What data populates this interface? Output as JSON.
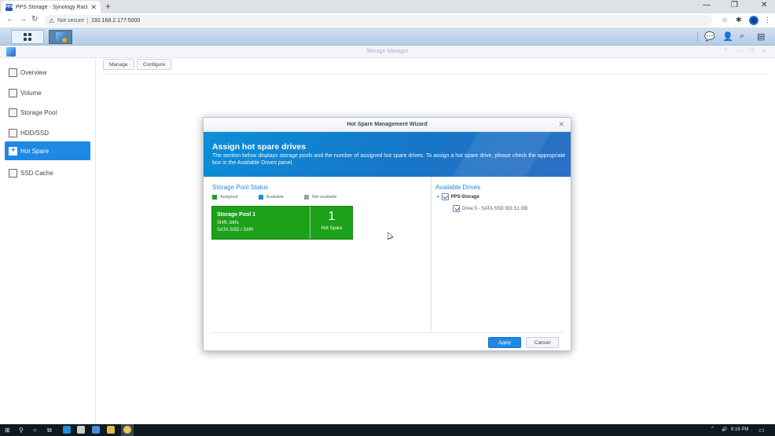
{
  "browser": {
    "tab_title": "PPS Storage - Synology RackSta",
    "tab_favicon_label": "PPS",
    "new_tab_symbol": "+",
    "url_security": "Not secure",
    "url": "192.168.2.177:5000"
  },
  "window": {
    "title": "Storage Manager"
  },
  "sidebar": {
    "items": [
      {
        "label": "Overview",
        "icon": "overview-icon",
        "active": false
      },
      {
        "label": "Volume",
        "icon": "volume-icon",
        "active": false
      },
      {
        "label": "Storage Pool",
        "icon": "storage-pool-icon",
        "active": false
      },
      {
        "label": "HDD/SSD",
        "icon": "hdd-icon",
        "active": false
      },
      {
        "label": "Hot Spare",
        "icon": "hot-spare-icon",
        "active": true
      },
      {
        "label": "SSD Cache",
        "icon": "ssd-cache-icon",
        "active": false
      }
    ]
  },
  "toolbar": {
    "manage_label": "Manage",
    "configure_label": "Configure"
  },
  "wizard": {
    "title": "Hot Spare Management Wizard",
    "heading": "Assign hot spare drives",
    "description": "The section below displays storage pools and the number of assigned hot spare drives. To assign a hot spare drive, please check the appropriate box in the Available Drives panel.",
    "pool_status_title": "Storage Pool Status",
    "legend": {
      "assigned": "Assigned",
      "available": "Available",
      "not_available": "Not available"
    },
    "pool": {
      "name": "Storage Pool 1",
      "type": "SHR, btrfs",
      "media": "SATA SSD / SHR",
      "hot_spare_count": "1",
      "hot_spare_label": "Hot Spare"
    },
    "available_drives_title": "Available Drives",
    "tree": {
      "group": "PPS-Storage",
      "drive": "Drive 5 - SATA SSD 931.51 GB"
    },
    "apply_label": "Apply",
    "cancel_label": "Cancel"
  },
  "taskbar": {
    "time": "6:16 PM"
  },
  "colors": {
    "accent": "#1e88e5",
    "assigned": "#1da01a",
    "available": "#1e88e5",
    "not_available": "#9e9e9e"
  }
}
